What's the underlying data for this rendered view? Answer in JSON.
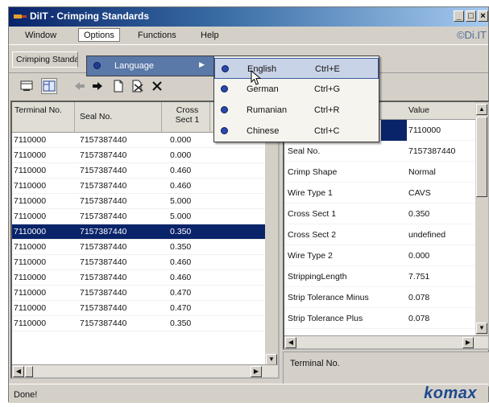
{
  "window": {
    "title": "DiIT - Crimping Standards",
    "controls": [
      "_",
      "□",
      "×"
    ]
  },
  "menubar": {
    "items": [
      "Window",
      "Options",
      "Functions",
      "Help"
    ],
    "active": "Options",
    "brand": "©Di.IT"
  },
  "tabs": [
    "Crimping Standards"
  ],
  "toolbar": {
    "icons": [
      "table-view-icon",
      "split-view-icon",
      "back-arrow-icon",
      "forward-arrow-icon",
      "new-document-icon",
      "delete-document-icon",
      "close-icon"
    ]
  },
  "options_menu": {
    "items": [
      {
        "label": "Language",
        "has_submenu": true
      }
    ]
  },
  "language_menu": {
    "items": [
      {
        "label": "English",
        "shortcut": "Ctrl+E"
      },
      {
        "label": "German",
        "shortcut": "Ctrl+G"
      },
      {
        "label": "Rumanian",
        "shortcut": "Ctrl+R"
      },
      {
        "label": "Chinese",
        "shortcut": "Ctrl+C"
      }
    ],
    "highlighted": "English"
  },
  "grid": {
    "headers": [
      "Terminal No.",
      "Seal No.",
      "Cross Sect 1"
    ],
    "rows": [
      [
        "7110000",
        "7157387440",
        "0.000"
      ],
      [
        "7110000",
        "7157387440",
        "0.000"
      ],
      [
        "7110000",
        "7157387440",
        "0.460"
      ],
      [
        "7110000",
        "7157387440",
        "0.460"
      ],
      [
        "7110000",
        "7157387440",
        "5.000"
      ],
      [
        "7110000",
        "7157387440",
        "5.000"
      ],
      [
        "7110000",
        "7157387440",
        "0.350"
      ],
      [
        "7110000",
        "7157387440",
        "0.350"
      ],
      [
        "7110000",
        "7157387440",
        "0.460"
      ],
      [
        "7110000",
        "7157387440",
        "0.460"
      ],
      [
        "7110000",
        "7157387440",
        "0.470"
      ],
      [
        "7110000",
        "7157387440",
        "0.470"
      ],
      [
        "7110000",
        "7157387440",
        "0.350"
      ]
    ],
    "selected_row": 6
  },
  "properties": {
    "value_header": "Value",
    "rows": [
      {
        "name": "",
        "value": "7110000"
      },
      {
        "name": "Seal No.",
        "value": "7157387440"
      },
      {
        "name": "Crimp Shape",
        "value": "Normal"
      },
      {
        "name": "Wire Type 1",
        "value": "CAVS"
      },
      {
        "name": "Cross Sect 1",
        "value": "0.350"
      },
      {
        "name": "Cross Sect 2",
        "value": "undefined"
      },
      {
        "name": "Wire Type 2",
        "value": "0.000"
      },
      {
        "name": "StrippingLength",
        "value": "7.751"
      },
      {
        "name": "Strip Tolerance Minus",
        "value": "0.078"
      },
      {
        "name": "Strip Tolerance Plus",
        "value": "0.078"
      }
    ],
    "description_label": "Terminal No."
  },
  "status": {
    "text": "Done!",
    "logo": "komax"
  },
  "colors": {
    "selection": "#0a246a",
    "title_bar": "#0a246a",
    "logo": "#1e4a8e"
  }
}
